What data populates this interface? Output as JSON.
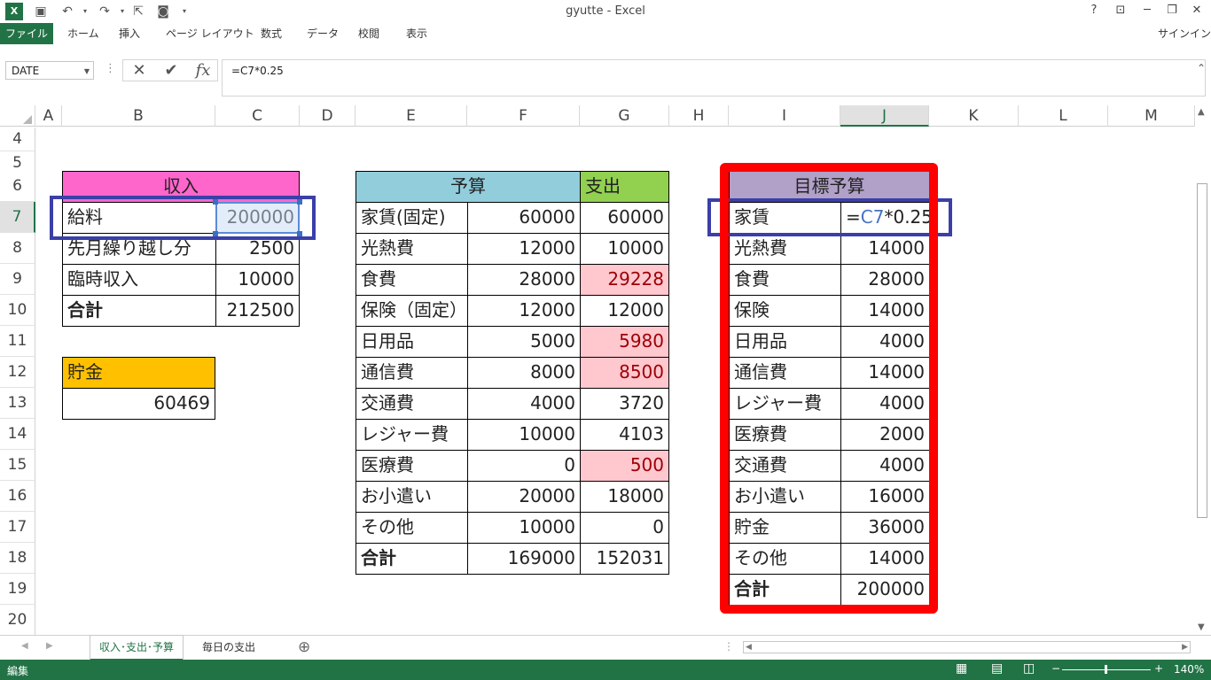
{
  "window": {
    "title": "gyutte - Excel",
    "help": "?",
    "minimize": "─",
    "restore": "❐",
    "close": "✕"
  },
  "ribbon": {
    "tabs": [
      "ファイル",
      "ホーム",
      "挿入",
      "ページ レイアウト",
      "数式",
      "データ",
      "校閲",
      "表示"
    ],
    "signin": "サインイン"
  },
  "formula_bar": {
    "name_box": "DATE",
    "cancel": "✕",
    "enter": "✔",
    "fx": "fx",
    "formula": "=C7*0.25"
  },
  "columns": [
    "A",
    "B",
    "C",
    "D",
    "E",
    "F",
    "G",
    "H",
    "I",
    "J",
    "K",
    "L",
    "M"
  ],
  "rows": [
    "4",
    "5",
    "6",
    "7",
    "8",
    "9",
    "10",
    "11",
    "12",
    "13",
    "14",
    "15",
    "16",
    "17",
    "18",
    "19",
    "20"
  ],
  "income": {
    "header": "収入",
    "rows": [
      {
        "label": "給料",
        "value": "200000"
      },
      {
        "label": "先月繰り越し分",
        "value": "2500"
      },
      {
        "label": "臨時収入",
        "value": "10000"
      },
      {
        "label": "合計",
        "value": "212500"
      }
    ]
  },
  "savings": {
    "header": "貯金",
    "value": "60469"
  },
  "budget": {
    "header_budget": "予算",
    "header_spend": "支出",
    "rows": [
      {
        "label": "家賃(固定)",
        "budget": "60000",
        "spend": "60000"
      },
      {
        "label": "光熱費",
        "budget": "12000",
        "spend": "10000"
      },
      {
        "label": "食費",
        "budget": "28000",
        "spend": "29228"
      },
      {
        "label": "保険（固定）",
        "budget": "12000",
        "spend": "12000"
      },
      {
        "label": "日用品",
        "budget": "5000",
        "spend": "5980"
      },
      {
        "label": "通信費",
        "budget": "8000",
        "spend": "8500"
      },
      {
        "label": "交通費",
        "budget": "4000",
        "spend": "3720"
      },
      {
        "label": "レジャー費",
        "budget": "10000",
        "spend": "4103"
      },
      {
        "label": "医療費",
        "budget": "0",
        "spend": "500"
      },
      {
        "label": "お小遣い",
        "budget": "20000",
        "spend": "18000"
      },
      {
        "label": "その他",
        "budget": "10000",
        "spend": "0"
      },
      {
        "label": "合計",
        "budget": "169000",
        "spend": "152031"
      }
    ]
  },
  "target": {
    "header": "目標予算",
    "editing": {
      "label": "家賃",
      "formula_eq": "=",
      "formula_ref": "C7",
      "formula_rest": "*0.25"
    },
    "rows": [
      {
        "label": "光熱費",
        "value": "14000"
      },
      {
        "label": "食費",
        "value": "28000"
      },
      {
        "label": "保険",
        "value": "14000"
      },
      {
        "label": "日用品",
        "value": "4000"
      },
      {
        "label": "通信費",
        "value": "14000"
      },
      {
        "label": "レジャー費",
        "value": "4000"
      },
      {
        "label": "医療費",
        "value": "2000"
      },
      {
        "label": "交通費",
        "value": "4000"
      },
      {
        "label": "お小遣い",
        "value": "16000"
      },
      {
        "label": "貯金",
        "value": "36000"
      },
      {
        "label": "その他",
        "value": "14000"
      },
      {
        "label": "合計",
        "value": "200000"
      }
    ]
  },
  "sheets": {
    "tabs": [
      "収入･支出･予算",
      "毎日の支出"
    ],
    "add": "⊕"
  },
  "status": {
    "mode": "編集",
    "zoom": "140%"
  },
  "colors": {
    "excel_green": "#217346",
    "income_header": "#ff66cc",
    "savings_header": "#ffc000",
    "budget_header": "#92cddc",
    "spend_header": "#92d050",
    "target_header": "#b1a0c7",
    "over_budget_fill": "#ffc7ce",
    "over_budget_text": "#9c0006",
    "highlight_blue": "#3b3fa8",
    "highlight_red": "#ff0000"
  }
}
